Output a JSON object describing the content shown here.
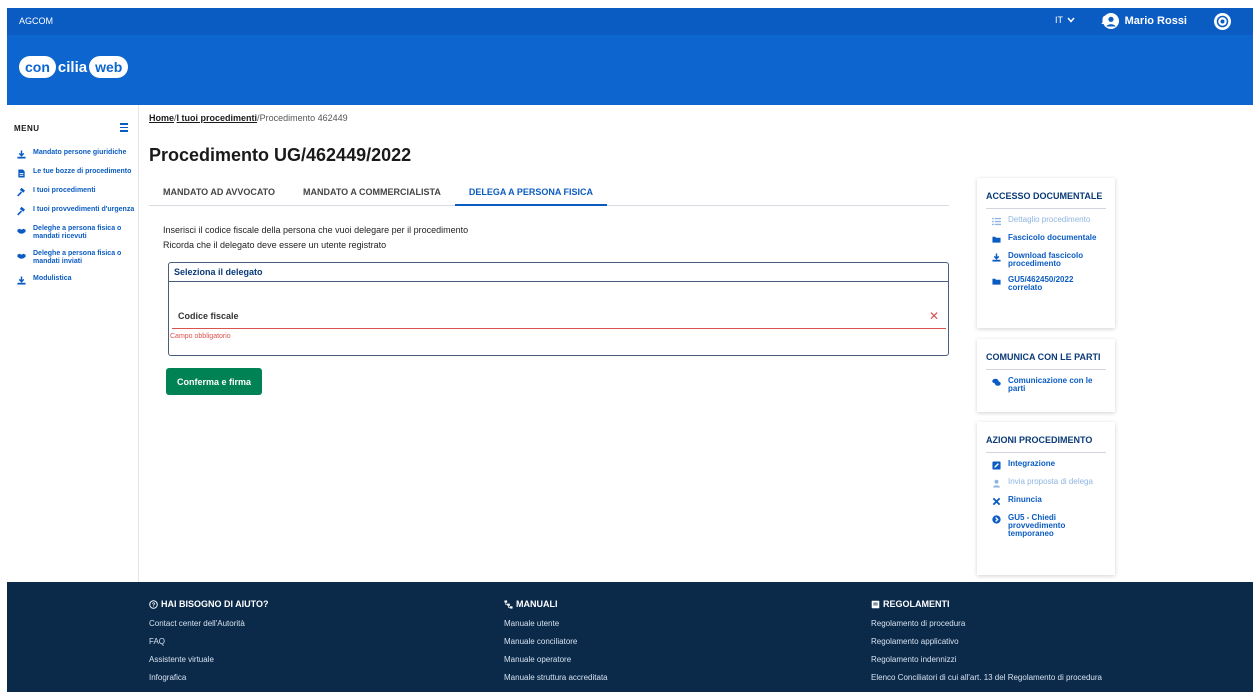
{
  "topbar": {
    "brand": "AGCOM",
    "language": "IT",
    "user_name": "Mario Rossi"
  },
  "logo": {
    "part1": "con",
    "part2": "cilia",
    "part3": "web"
  },
  "sidebar": {
    "title": "MENU",
    "items": [
      {
        "label": "Mandato persone giuridiche",
        "icon": "download-icon"
      },
      {
        "label": "Le tue bozze di procedimento",
        "icon": "document-icon"
      },
      {
        "label": "I tuoi procedimenti",
        "icon": "gavel-icon"
      },
      {
        "label": "I tuoi provvedimenti d'urgenza",
        "icon": "gavel-icon"
      },
      {
        "label": "Deleghe a persona fisica o mandati ricevuti",
        "icon": "handshake-icon"
      },
      {
        "label": "Deleghe a persona fisica o mandati inviati",
        "icon": "handshake-icon"
      },
      {
        "label": "Modulistica",
        "icon": "download-icon"
      }
    ]
  },
  "breadcrumb": {
    "home": "Home",
    "sep": "/",
    "procedures": "I tuoi procedimenti",
    "current": "Procedimento 462449"
  },
  "page": {
    "title": "Procedimento UG/462449/2022"
  },
  "tabs": [
    {
      "label": "MANDATO AD AVVOCATO"
    },
    {
      "label": "MANDATO A COMMERCIALISTA"
    },
    {
      "label": "DELEGA A PERSONA FISICA"
    }
  ],
  "instructions": {
    "line1": "Inserisci il codice fiscale della persona che vuoi delegare per il procedimento",
    "line2": "Ricorda che il delegato deve essere un utente registrato"
  },
  "delegate_card": {
    "title": "Seleziona il delegato",
    "field_label": "Codice fiscale",
    "error": "Campo obbligatorio"
  },
  "confirm_button": "Conferma e firma",
  "panels": {
    "documents": {
      "title": "ACCESSO DOCUMENTALE",
      "items": [
        {
          "label": "Dettaglio procedimento",
          "icon": "list-icon",
          "disabled": true
        },
        {
          "label": "Fascicolo documentale",
          "icon": "folder-icon",
          "disabled": false
        },
        {
          "label": "Download fascicolo procedimento",
          "icon": "download-icon",
          "disabled": false
        },
        {
          "label": "GU5/462450/2022 correlato",
          "icon": "folder-icon",
          "disabled": false
        }
      ]
    },
    "communicate": {
      "title": "COMUNICA CON LE PARTI",
      "items": [
        {
          "label": "Comunicazione con le parti",
          "icon": "chat-icon",
          "disabled": false
        }
      ]
    },
    "actions": {
      "title": "AZIONI PROCEDIMENTO",
      "items": [
        {
          "label": "Integrazione",
          "icon": "edit-icon",
          "disabled": false
        },
        {
          "label": "Invia proposta di delega",
          "icon": "user-icon",
          "disabled": true
        },
        {
          "label": "Rinuncia",
          "icon": "times-icon",
          "disabled": false
        },
        {
          "label": "GU5 - Chiedi provvedimento temporaneo",
          "icon": "arrow-circle-icon",
          "disabled": false
        }
      ]
    }
  },
  "footer": {
    "help": {
      "title": "HAI BISOGNO DI AIUTO?",
      "links": [
        "Contact center dell'Autorità",
        "FAQ",
        "Assistente virtuale",
        "Infografica"
      ]
    },
    "manuals": {
      "title": "MANUALI",
      "links": [
        "Manuale utente",
        "Manuale conciliatore",
        "Manuale operatore",
        "Manuale struttura accreditata"
      ]
    },
    "regulations": {
      "title": "REGOLAMENTI",
      "links": [
        "Regolamento di procedura",
        "Regolamento applicativo",
        "Regolamento indennizzi",
        "Elenco Conciliatori di cui all'art. 13 del Regolamento di procedura"
      ]
    }
  },
  "colors": {
    "primary": "#0b5cc2",
    "header": "#0d66d0",
    "footer": "#0b2a4a",
    "confirm": "#008255",
    "error": "#d9534f"
  }
}
